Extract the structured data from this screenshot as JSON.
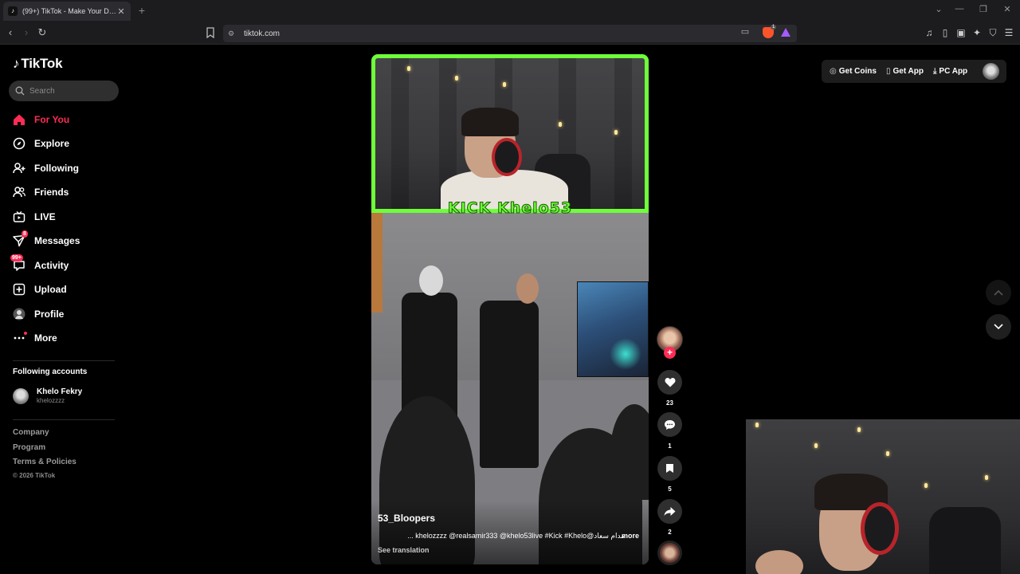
{
  "browser": {
    "tab_title": "(99+) TikTok - Make Your Day",
    "url": "tiktok.com",
    "brave_badge": "1"
  },
  "sidebar": {
    "logo": "TikTok",
    "search_placeholder": "Search",
    "nav": [
      {
        "label": "For You",
        "icon": "home-icon",
        "active": true
      },
      {
        "label": "Explore",
        "icon": "compass-icon"
      },
      {
        "label": "Following",
        "icon": "user-plus-icon"
      },
      {
        "label": "Friends",
        "icon": "friends-icon"
      },
      {
        "label": "LIVE",
        "icon": "tv-icon"
      },
      {
        "label": "Messages",
        "icon": "paper-plane-icon",
        "badge": "8"
      },
      {
        "label": "Activity",
        "icon": "message-icon",
        "badge": "99+"
      },
      {
        "label": "Upload",
        "icon": "plus-square-icon"
      },
      {
        "label": "Profile",
        "icon": "avatar-icon"
      },
      {
        "label": "More",
        "icon": "more-icon"
      }
    ],
    "following_title": "Following accounts",
    "following_accounts": [
      {
        "name": "Khelo Fekry",
        "handle": "khelozzzz"
      }
    ],
    "footer": [
      "Company",
      "Program",
      "Terms & Policies"
    ],
    "copyright": "© 2026 TikTok"
  },
  "video": {
    "overlay_text": "KICK Khelo53",
    "author": "53_Bloopers",
    "caption": "مدام سعاد@khelozzzz @realsamir333 @khelo53live #Kick #Khelo ...",
    "more": "more",
    "see_translation": "See translation"
  },
  "actions": {
    "likes": "23",
    "comments": "1",
    "saves": "5",
    "shares": "2"
  },
  "topbar": {
    "get_coins": "Get Coins",
    "get_app": "Get App",
    "pc_app": "PC App"
  },
  "colors": {
    "accent": "#fe2c55",
    "overlay_green": "#6fff3a",
    "background": "#000000"
  }
}
